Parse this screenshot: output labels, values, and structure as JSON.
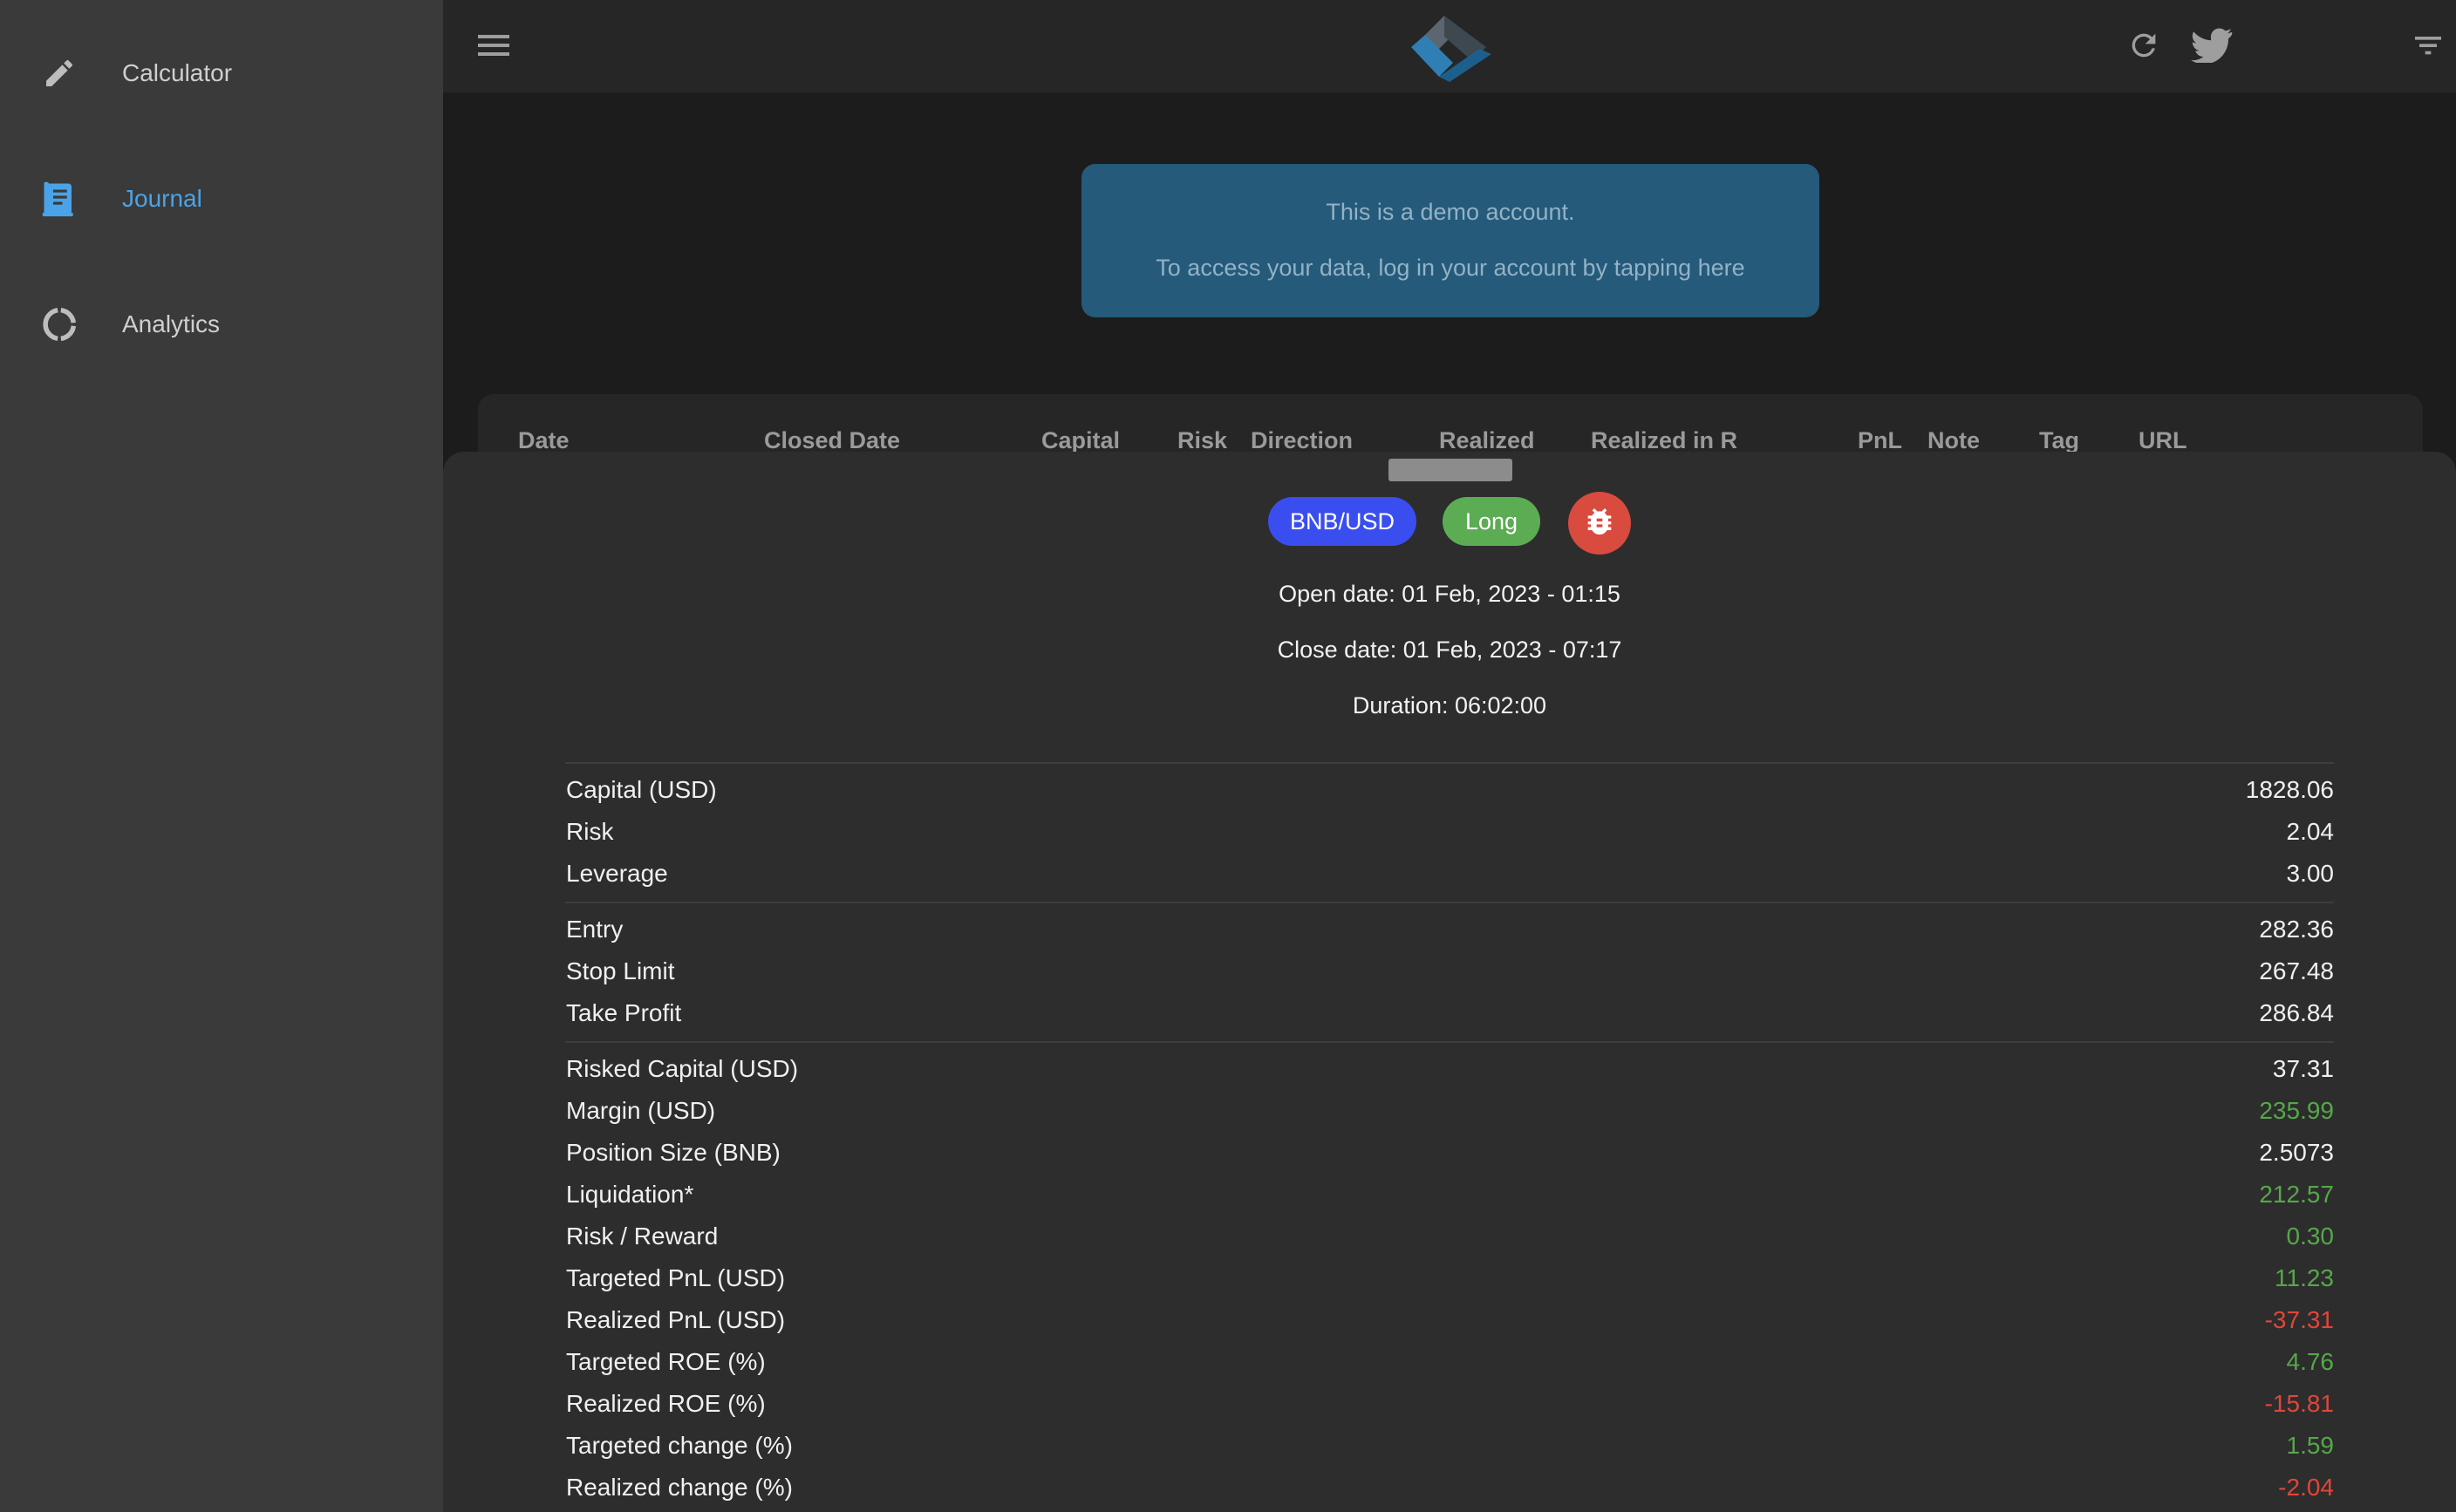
{
  "sidebar": {
    "items": [
      {
        "label": "Calculator",
        "icon": "pencil-icon"
      },
      {
        "label": "Journal",
        "icon": "journal-icon",
        "active": true
      },
      {
        "label": "Analytics",
        "icon": "donut-chart-icon"
      }
    ]
  },
  "topbar": {
    "icons": [
      "menu-icon",
      "app-logo",
      "refresh-icon",
      "twitter-icon",
      "filter-icon"
    ]
  },
  "banner": {
    "line1": "This is a demo account.",
    "line2": "To access your data, log in your account by tapping here"
  },
  "table": {
    "columns": [
      "Date",
      "Closed Date",
      "Capital",
      "Risk",
      "Direction",
      "Realized",
      "Realized in R",
      "PnL",
      "Note",
      "Tag",
      "URL"
    ]
  },
  "trade": {
    "pair": "BNB/USD",
    "direction": "Long",
    "open_date": "Open date: 01 Feb, 2023 - 01:15",
    "close_date": "Close date: 01 Feb, 2023 - 07:17",
    "duration": "Duration: 06:02:00",
    "rows": [
      {
        "label": "Capital (USD)",
        "value": "1828.06",
        "color": "white"
      },
      {
        "label": "Risk",
        "value": "2.04",
        "color": "white"
      },
      {
        "label": "Leverage",
        "value": "3.00",
        "color": "white"
      },
      {
        "label": "Entry",
        "value": "282.36",
        "color": "white"
      },
      {
        "label": "Stop Limit",
        "value": "267.48",
        "color": "white"
      },
      {
        "label": "Take Profit",
        "value": "286.84",
        "color": "white"
      },
      {
        "label": "Risked Capital (USD)",
        "value": "37.31",
        "color": "white"
      },
      {
        "label": "Margin (USD)",
        "value": "235.99",
        "color": "green"
      },
      {
        "label": "Position Size (BNB)",
        "value": "2.5073",
        "color": "white"
      },
      {
        "label": "Liquidation*",
        "value": "212.57",
        "color": "green"
      },
      {
        "label": "Risk / Reward",
        "value": "0.30",
        "color": "green"
      },
      {
        "label": "Targeted PnL (USD)",
        "value": "11.23",
        "color": "green"
      },
      {
        "label": "Realized PnL (USD)",
        "value": "-37.31",
        "color": "red"
      },
      {
        "label": "Targeted ROE (%)",
        "value": "4.76",
        "color": "green"
      },
      {
        "label": "Realized ROE (%)",
        "value": "-15.81",
        "color": "red"
      },
      {
        "label": "Targeted change (%)",
        "value": "1.59",
        "color": "green"
      },
      {
        "label": "Realized change (%)",
        "value": "-2.04",
        "color": "red"
      }
    ]
  },
  "colors": {
    "accent_blue": "#4aa3e8",
    "pair_chip": "#3a4ef0",
    "long_chip": "#5cac54",
    "bug_button": "#d94a3f",
    "positive": "#56a74a",
    "negative": "#e0463a"
  }
}
